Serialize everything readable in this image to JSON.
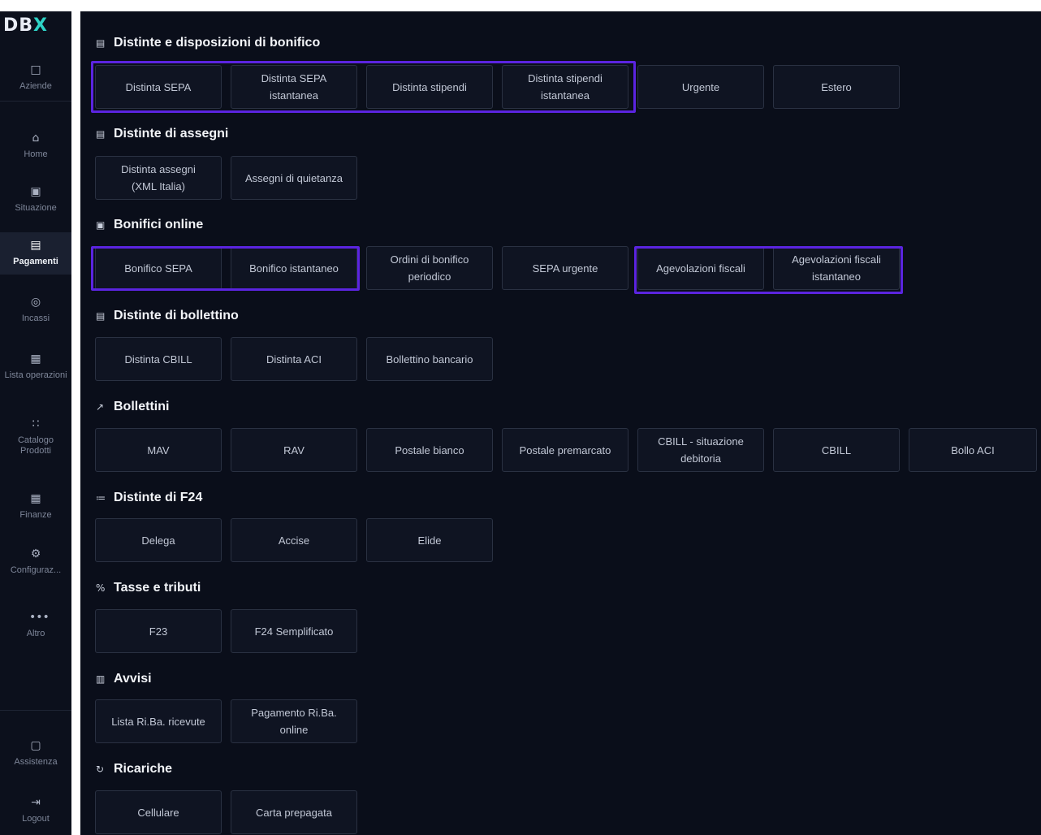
{
  "app": {
    "logo": {
      "main": "DB",
      "accent": "X"
    }
  },
  "sidebar": {
    "items": [
      {
        "id": "aziende",
        "icon": "building-icon",
        "glyph": "□",
        "label": "Aziende"
      },
      {
        "id": "home",
        "icon": "home-icon",
        "glyph": "⌂",
        "label": "Home"
      },
      {
        "id": "situazione",
        "icon": "chart-icon",
        "glyph": "▣",
        "label": "Situazione"
      },
      {
        "id": "pagamenti",
        "icon": "payment-icon",
        "glyph": "▤",
        "label": "Pagamenti",
        "active": true
      },
      {
        "id": "incassi",
        "icon": "coin-icon",
        "glyph": "◎",
        "label": "Incassi"
      },
      {
        "id": "lista-operazioni",
        "icon": "list-icon",
        "glyph": "▦",
        "label": "Lista operazioni"
      },
      {
        "id": "catalogo-prodotti",
        "icon": "grid-icon",
        "glyph": "∷",
        "label": "Catalogo Prodotti"
      },
      {
        "id": "finanze",
        "icon": "finance-icon",
        "glyph": "▦",
        "label": "Finanze"
      },
      {
        "id": "configurazione",
        "icon": "gear-icon",
        "glyph": "⚙",
        "label": "Configuraz..."
      },
      {
        "id": "altro",
        "icon": "more-icon",
        "glyph": "•••",
        "label": "Altro"
      },
      {
        "id": "assistenza",
        "icon": "chat-icon",
        "glyph": "▢",
        "label": "Assistenza"
      },
      {
        "id": "logout",
        "icon": "logout-icon",
        "glyph": "⇥",
        "label": "Logout"
      }
    ]
  },
  "sections": [
    {
      "title": "Distinte e disposizioni di bonifico",
      "icon": "bank-transfer-icon",
      "glyph": "▤",
      "items": [
        "Distinta SEPA",
        "Distinta SEPA istantanea",
        "Distinta stipendi",
        "Distinta stipendi istantanea",
        "Urgente",
        "Estero"
      ]
    },
    {
      "title": "Distinte di assegni",
      "icon": "check-icon",
      "glyph": "▤",
      "items": [
        "Distinta assegni (XML Italia)",
        "Assegni di quietanza"
      ]
    },
    {
      "title": "Bonifici online",
      "icon": "online-transfer-icon",
      "glyph": "▣",
      "items": [
        "Bonifico SEPA",
        "Bonifico istantaneo",
        "Ordini di bonifico periodico",
        "SEPA urgente",
        "Agevolazioni fiscali",
        "Agevolazioni fiscali istantaneo"
      ]
    },
    {
      "title": "Distinte di bollettino",
      "icon": "slip-list-icon",
      "glyph": "▤",
      "items": [
        "Distinta CBILL",
        "Distinta ACI",
        "Bollettino bancario"
      ]
    },
    {
      "title": "Bollettini",
      "icon": "slip-icon",
      "glyph": "↗",
      "items": [
        "MAV",
        "RAV",
        "Postale bianco",
        "Postale premarcato",
        "CBILL - situazione debitoria",
        "CBILL",
        "Bollo ACI"
      ]
    },
    {
      "title": "Distinte di F24",
      "icon": "f24-icon",
      "glyph": "≔",
      "items": [
        "Delega",
        "Accise",
        "Elide"
      ]
    },
    {
      "title": "Tasse e tributi",
      "icon": "percent-icon",
      "glyph": "%",
      "items": [
        "F23",
        "F24 Semplificato"
      ]
    },
    {
      "title": "Avvisi",
      "icon": "notice-icon",
      "glyph": "▥",
      "items": [
        "Lista Ri.Ba. ricevute",
        "Pagamento Ri.Ba. online"
      ]
    },
    {
      "title": "Ricariche",
      "icon": "refresh-icon",
      "glyph": "↻",
      "items": [
        "Cellulare",
        "Carta prepagata"
      ]
    }
  ],
  "colors": {
    "highlight": "#5b24e0",
    "background": "#0a0e1a",
    "tile_border": "#2a3142"
  }
}
